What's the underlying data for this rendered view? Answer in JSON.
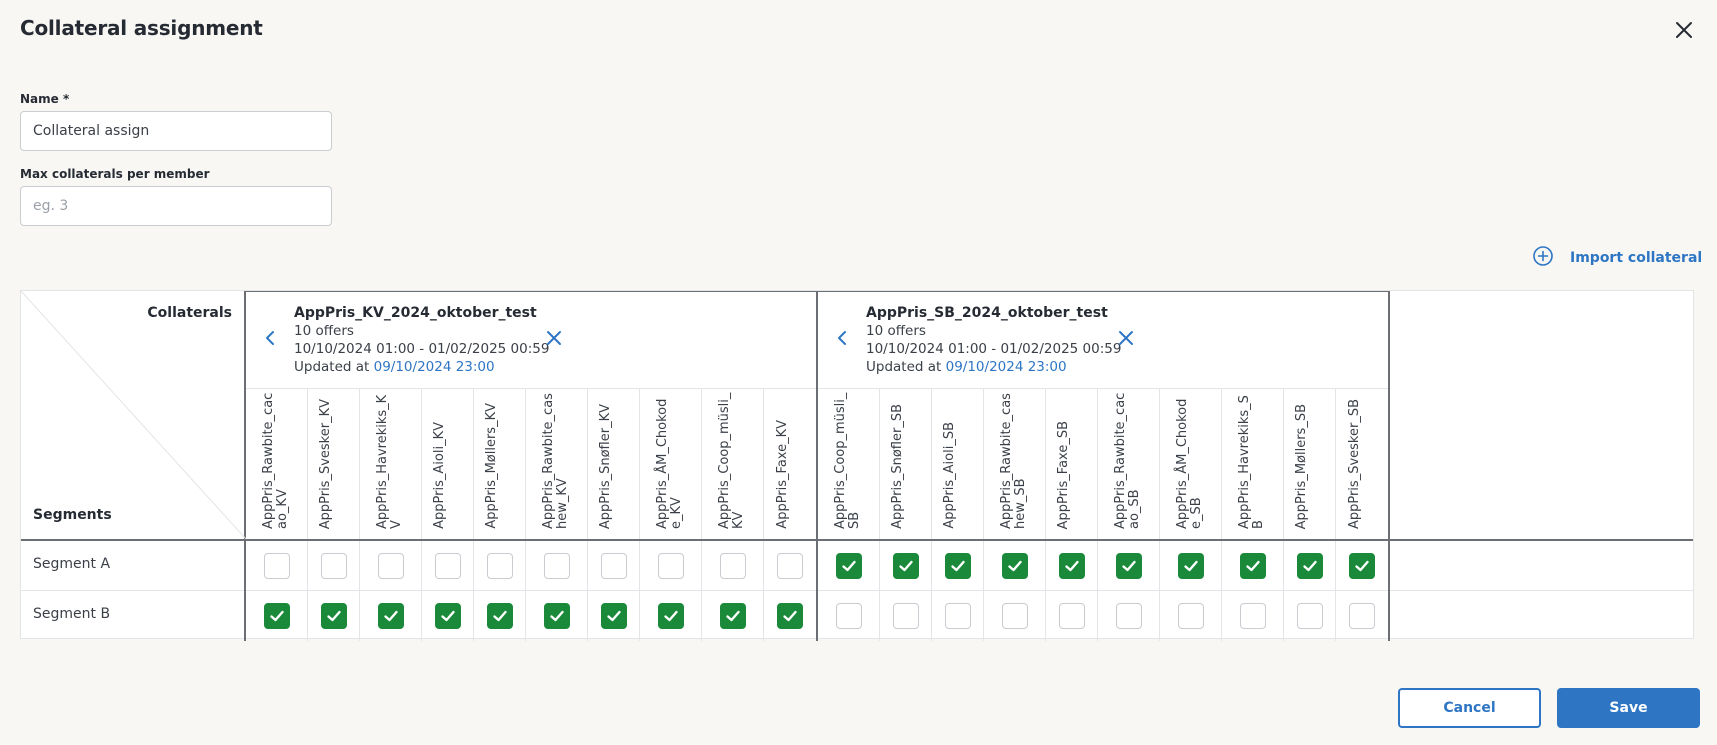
{
  "dialog": {
    "title": "Collateral assignment"
  },
  "form": {
    "name_label": "Name *",
    "name_value": "Collateral assign",
    "max_label": "Max collaterals per member",
    "max_placeholder": "eg. 3"
  },
  "import_label": "Import collateral",
  "grid": {
    "corner_collaterals": "Collaterals",
    "corner_segments": "Segments",
    "groups": [
      {
        "name": "AppPris_KV_2024_oktober_test",
        "offers": "10 offers",
        "range": "10/10/2024 01:00 - 01/02/2025 00:59",
        "updated_prefix": "Updated at ",
        "updated_at": "09/10/2024 23:00",
        "columns": [
          "AppPris_Rawbite_cacao_KV",
          "AppPris_Svesker_KV",
          "AppPris_Havrekiks_KV",
          "AppPris_Aioli_KV",
          "AppPris_Møllers_KV",
          "AppPris_Rawbite_cashew_KV",
          "AppPris_Snøfler_KV",
          "AppPris_ÅM_Chokode_KV",
          "AppPris_Coop_müsli_KV",
          "AppPris_Faxe_KV"
        ]
      },
      {
        "name": "AppPris_SB_2024_oktober_test",
        "offers": "10 offers",
        "range": "10/10/2024 01:00 - 01/02/2025 00:59",
        "updated_prefix": "Updated at ",
        "updated_at": "09/10/2024 23:00",
        "columns": [
          "AppPris_Coop_müsli_SB",
          "AppPris_Snøfler_SB",
          "AppPris_Aioli_SB",
          "AppPris_Rawbite_cashew_SB",
          "AppPris_Faxe_SB",
          "AppPris_Rawbite_cacao_SB",
          "AppPris_ÅM_Chokode_SB",
          "AppPris_Havrekiks_SB",
          "AppPris_Møllers_SB",
          "AppPris_Svesker_SB"
        ]
      }
    ],
    "rows": [
      {
        "label": "Segment A",
        "checks": [
          false,
          false,
          false,
          false,
          false,
          false,
          false,
          false,
          false,
          false,
          true,
          true,
          true,
          true,
          true,
          true,
          true,
          true,
          true,
          true
        ]
      },
      {
        "label": "Segment B",
        "checks": [
          true,
          true,
          true,
          true,
          true,
          true,
          true,
          true,
          true,
          true,
          false,
          false,
          false,
          false,
          false,
          false,
          false,
          false,
          false,
          false
        ]
      }
    ]
  },
  "actions": {
    "cancel": "Cancel",
    "save": "Save"
  },
  "colors": {
    "accent": "#2e76c4",
    "check": "#1a8a3a"
  }
}
